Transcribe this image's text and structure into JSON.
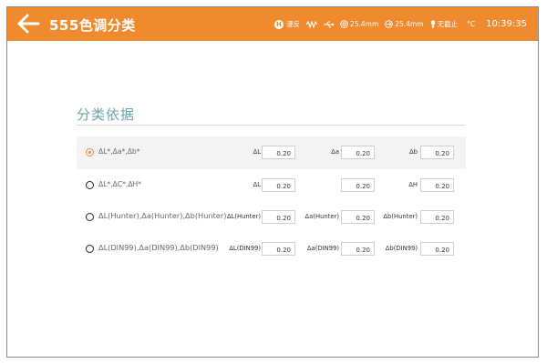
{
  "header": {
    "title": "555色调分类",
    "status": {
      "mode_badge": "H",
      "mode_label": "漫反",
      "aperture1": "25.4mm",
      "aperture2": "25.4mm",
      "uv_label": "无截止",
      "temp_unit": "°C",
      "time": "10:39:35"
    },
    "color": "#ef8a2e"
  },
  "section": {
    "title": "分类依据"
  },
  "options": [
    {
      "label": "ΔL*,Δa*,Δb*",
      "selected": true,
      "fields": [
        {
          "label": "ΔL",
          "value": "0.20"
        },
        {
          "label": "Δa",
          "value": "0.20"
        },
        {
          "label": "Δb",
          "value": "0.20"
        }
      ]
    },
    {
      "label": "ΔL*,ΔC*,ΔH*",
      "selected": false,
      "fields": [
        {
          "label": "ΔL",
          "value": "0.20"
        },
        {
          "label": "",
          "value": "0.20"
        },
        {
          "label": "ΔH",
          "value": "0.20"
        }
      ]
    },
    {
      "label": "ΔL(Hunter),Δa(Hunter),Δb(Hunter)",
      "selected": false,
      "fields": [
        {
          "label": "ΔL(Hunter)",
          "value": "0.20"
        },
        {
          "label": "Δa(Hunter)",
          "value": "0.20"
        },
        {
          "label": "Δb(Hunter)",
          "value": "0.20"
        }
      ]
    },
    {
      "label": "ΔL(DIN99),Δa(DIN99),Δb(DIN99)",
      "selected": false,
      "fields": [
        {
          "label": "ΔL(DIN99)",
          "value": "0.20"
        },
        {
          "label": "Δa(DIN99)",
          "value": "0.20"
        },
        {
          "label": "Δb(DIN99)",
          "value": "0.20"
        }
      ]
    }
  ]
}
